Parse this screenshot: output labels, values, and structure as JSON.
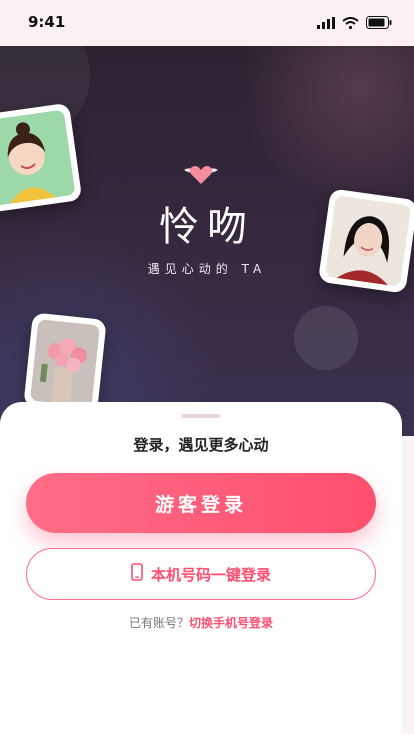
{
  "status_bar": {
    "time": "9:41"
  },
  "hero": {
    "app_title": "怜吻",
    "tagline": "遇见心动的 TA"
  },
  "sheet": {
    "title": "登录，遇见更多心动",
    "guest_login_label": "游客登录",
    "phone_login_label": "本机号码一键登录",
    "has_account_text": "已有账号？",
    "switch_link_label": "切换手机号登录"
  },
  "colors": {
    "accent": "#ff4f6f",
    "accent_light": "#ff6d87",
    "hero_dark": "#2c2230"
  },
  "icons": [
    "signal-icon",
    "wifi-icon",
    "battery-icon",
    "winged-heart-icon",
    "phone-icon"
  ]
}
